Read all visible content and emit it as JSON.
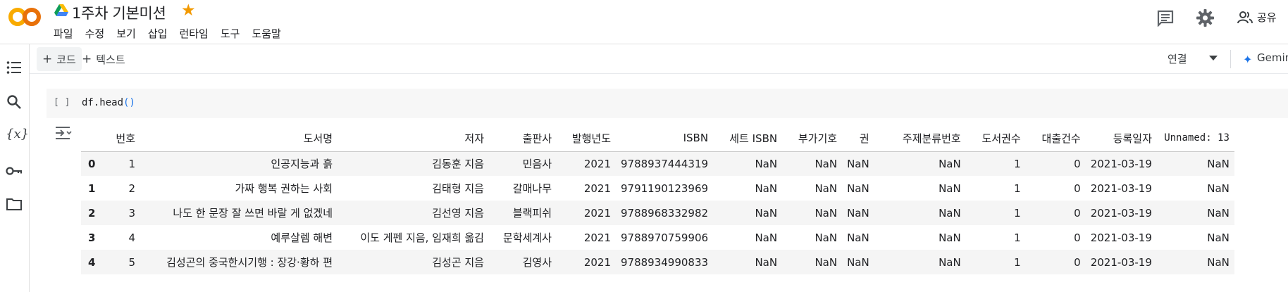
{
  "app": {
    "notebook_title": "1주차 기본미션",
    "menu": [
      "파일",
      "수정",
      "보기",
      "삽입",
      "런타임",
      "도구",
      "도움말"
    ],
    "share_label": "공유"
  },
  "toolbar": {
    "code_label": "코드",
    "text_label": "텍스트",
    "connect_label": "연결",
    "gemini_label": "Gemin"
  },
  "cell": {
    "run_indicator": "[ ]",
    "code_func": "df.head",
    "code_parens": "()"
  },
  "table": {
    "columns": [
      "",
      "번호",
      "도서명",
      "저자",
      "출판사",
      "발행년도",
      "ISBN",
      "세트 ISBN",
      "부가기호",
      "권",
      "주제분류번호",
      "도서권수",
      "대출건수",
      "등록일자",
      "Unnamed: 13"
    ],
    "rows": [
      [
        "0",
        "1",
        "인공지능과 흙",
        "김동훈 지음",
        "민음사",
        "2021",
        "9788937444319",
        "NaN",
        "NaN",
        "NaN",
        "NaN",
        "1",
        "0",
        "2021-03-19",
        "NaN"
      ],
      [
        "1",
        "2",
        "가짜 행복 권하는 사회",
        "김태형 지음",
        "갈매나무",
        "2021",
        "9791190123969",
        "NaN",
        "NaN",
        "NaN",
        "NaN",
        "1",
        "0",
        "2021-03-19",
        "NaN"
      ],
      [
        "2",
        "3",
        "나도 한 문장 잘 쓰면 바랄 게 없겠네",
        "김선영 지음",
        "블랙피쉬",
        "2021",
        "9788968332982",
        "NaN",
        "NaN",
        "NaN",
        "NaN",
        "1",
        "0",
        "2021-03-19",
        "NaN"
      ],
      [
        "3",
        "4",
        "예루살렘 해변",
        "이도 게펜 지음, 임재희 옮김",
        "문학세계사",
        "2021",
        "9788970759906",
        "NaN",
        "NaN",
        "NaN",
        "NaN",
        "1",
        "0",
        "2021-03-19",
        "NaN"
      ],
      [
        "4",
        "5",
        "김성곤의 중국한시기행 : 장강·황하 편",
        "김성곤 지음",
        "김영사",
        "2021",
        "9788934990833",
        "NaN",
        "NaN",
        "NaN",
        "NaN",
        "1",
        "0",
        "2021-03-19",
        "NaN"
      ]
    ]
  },
  "colors": {
    "logo_orange": "#f9ab00",
    "logo_dark_orange": "#e8710a",
    "star": "#f29900",
    "accent_blue": "#1a73e8"
  }
}
